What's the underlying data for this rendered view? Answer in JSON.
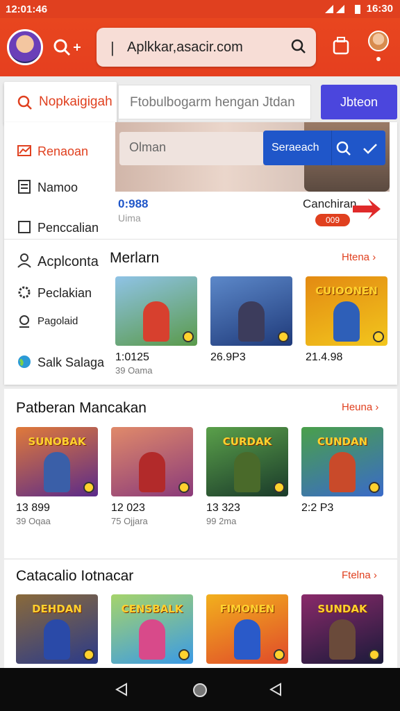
{
  "status": {
    "time_left": "12:01:46",
    "time_right": "16:30"
  },
  "browser": {
    "url": "Aplkkar,asacir.com"
  },
  "tabs": {
    "active_label": "Nopkaigigah",
    "query": "Ftobulbogarm hengan  Jtdan",
    "action_label": "Jbteon"
  },
  "inner_search": {
    "placeholder": "Olman",
    "button_label": "Seraeach"
  },
  "menu": {
    "items": [
      {
        "label": "Renaoan",
        "icon": "chart-icon"
      },
      {
        "label": "Namoo",
        "icon": "document-icon"
      },
      {
        "label": "Penccalian",
        "icon": "box-icon"
      },
      {
        "label": "Acplconta",
        "icon": "person-icon"
      },
      {
        "label": "Peclakian",
        "icon": "gear-icon"
      },
      {
        "label": "Pagolaid",
        "icon": "settings-icon"
      },
      {
        "label": "Salk  Salaga",
        "icon": "globe-icon"
      }
    ]
  },
  "stats": {
    "value": "0:988",
    "sub": "Uima"
  },
  "promo": {
    "title": "Canchiran",
    "badge": "009"
  },
  "section1": {
    "title": "Merlarn",
    "more": "Htena",
    "games": [
      {
        "title": "",
        "v1": "1:0125",
        "v2": "39 Oama",
        "colors": [
          "#5a9a4a",
          "#8fc3e6"
        ],
        "fig": "#d7402e"
      },
      {
        "title": "",
        "v1": "26.9P3",
        "v2": "",
        "colors": [
          "#1f3a7a",
          "#5c88c9"
        ],
        "fig": "#3c3c5c"
      },
      {
        "title": "CUIOONEN",
        "v1": "21.4.98",
        "v2": "",
        "colors": [
          "#f2c61d",
          "#e38a12"
        ],
        "fig": "#2e5fb8"
      }
    ]
  },
  "section2": {
    "title": "Patberan Mancakan",
    "more": "Heuna",
    "games": [
      {
        "title": "SUNOBAK",
        "v1": "13 899",
        "v2": "39 Oqaa",
        "colors": [
          "#5a2a8a",
          "#e07a3a"
        ],
        "fig": "#3a5fa8"
      },
      {
        "title": "",
        "v1": "12 023",
        "v2": "75 Ojjara",
        "colors": [
          "#8a3a7a",
          "#e08a6a"
        ],
        "fig": "#b22a2a"
      },
      {
        "title": "CURDAK",
        "v1": "13 323",
        "v2": "99 2ma",
        "colors": [
          "#1a3a2a",
          "#5aa04a"
        ],
        "fig": "#4a6a2a"
      },
      {
        "title": "CUNDAN",
        "v1": "2:2 P3",
        "v2": "",
        "colors": [
          "#3a6ac9",
          "#4aa04a"
        ],
        "fig": "#c94a2a"
      }
    ]
  },
  "section3": {
    "title": "Catacalio Iotnacar",
    "more": "Ftelna",
    "games": [
      {
        "title": "DEHDAN",
        "colors": [
          "#2a3a8a",
          "#8a6a3a"
        ],
        "fig": "#2a4aa8"
      },
      {
        "title": "CENSBALK",
        "colors": [
          "#3a9ae6",
          "#a6d46a"
        ],
        "fig": "#d84a8a"
      },
      {
        "title": "FIMONEN",
        "colors": [
          "#e04a2a",
          "#f2b01d"
        ],
        "fig": "#2a5ac9"
      },
      {
        "title": "SUNDAK",
        "colors": [
          "#1a1a3a",
          "#8a2a6a"
        ],
        "fig": "#6a4a3a"
      }
    ]
  }
}
